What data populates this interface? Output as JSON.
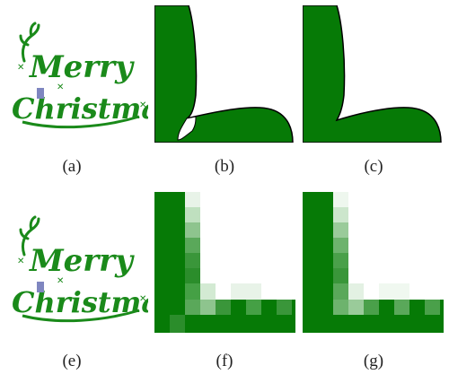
{
  "figure": {
    "captions": {
      "a": "(a)",
      "b": "(b)",
      "c": "(c)",
      "e": "(e)",
      "f": "(f)",
      "g": "(g)"
    },
    "logo_text": {
      "line1": "Merry",
      "line2": "Christmas"
    },
    "colors": {
      "green": "#1a8a1a",
      "dark_green": "#067a06",
      "outline": "#000000",
      "accent_blue": "#7f86c0"
    }
  }
}
